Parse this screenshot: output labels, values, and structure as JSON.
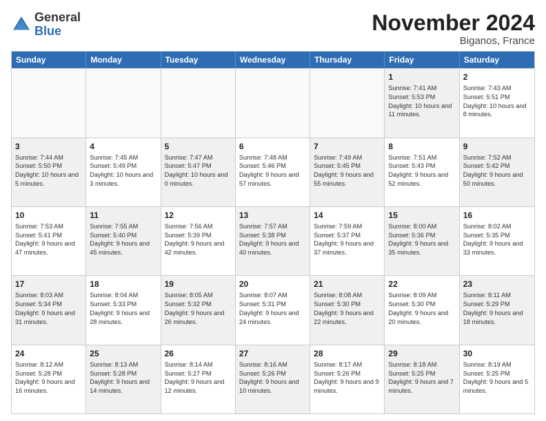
{
  "logo": {
    "general": "General",
    "blue": "Blue"
  },
  "header": {
    "month": "November 2024",
    "location": "Biganos, France"
  },
  "weekdays": [
    "Sunday",
    "Monday",
    "Tuesday",
    "Wednesday",
    "Thursday",
    "Friday",
    "Saturday"
  ],
  "rows": [
    [
      {
        "day": "",
        "text": "",
        "empty": true
      },
      {
        "day": "",
        "text": "",
        "empty": true
      },
      {
        "day": "",
        "text": "",
        "empty": true
      },
      {
        "day": "",
        "text": "",
        "empty": true
      },
      {
        "day": "",
        "text": "",
        "empty": true
      },
      {
        "day": "1",
        "text": "Sunrise: 7:41 AM\nSunset: 5:53 PM\nDaylight: 10 hours and 11 minutes.",
        "empty": false,
        "shaded": true
      },
      {
        "day": "2",
        "text": "Sunrise: 7:43 AM\nSunset: 5:51 PM\nDaylight: 10 hours and 8 minutes.",
        "empty": false,
        "shaded": false
      }
    ],
    [
      {
        "day": "3",
        "text": "Sunrise: 7:44 AM\nSunset: 5:50 PM\nDaylight: 10 hours and 5 minutes.",
        "empty": false,
        "shaded": true
      },
      {
        "day": "4",
        "text": "Sunrise: 7:45 AM\nSunset: 5:49 PM\nDaylight: 10 hours and 3 minutes.",
        "empty": false,
        "shaded": false
      },
      {
        "day": "5",
        "text": "Sunrise: 7:47 AM\nSunset: 5:47 PM\nDaylight: 10 hours and 0 minutes.",
        "empty": false,
        "shaded": true
      },
      {
        "day": "6",
        "text": "Sunrise: 7:48 AM\nSunset: 5:46 PM\nDaylight: 9 hours and 57 minutes.",
        "empty": false,
        "shaded": false
      },
      {
        "day": "7",
        "text": "Sunrise: 7:49 AM\nSunset: 5:45 PM\nDaylight: 9 hours and 55 minutes.",
        "empty": false,
        "shaded": true
      },
      {
        "day": "8",
        "text": "Sunrise: 7:51 AM\nSunset: 5:43 PM\nDaylight: 9 hours and 52 minutes.",
        "empty": false,
        "shaded": false
      },
      {
        "day": "9",
        "text": "Sunrise: 7:52 AM\nSunset: 5:42 PM\nDaylight: 9 hours and 50 minutes.",
        "empty": false,
        "shaded": true
      }
    ],
    [
      {
        "day": "10",
        "text": "Sunrise: 7:53 AM\nSunset: 5:41 PM\nDaylight: 9 hours and 47 minutes.",
        "empty": false,
        "shaded": false
      },
      {
        "day": "11",
        "text": "Sunrise: 7:55 AM\nSunset: 5:40 PM\nDaylight: 9 hours and 45 minutes.",
        "empty": false,
        "shaded": true
      },
      {
        "day": "12",
        "text": "Sunrise: 7:56 AM\nSunset: 5:39 PM\nDaylight: 9 hours and 42 minutes.",
        "empty": false,
        "shaded": false
      },
      {
        "day": "13",
        "text": "Sunrise: 7:57 AM\nSunset: 5:38 PM\nDaylight: 9 hours and 40 minutes.",
        "empty": false,
        "shaded": true
      },
      {
        "day": "14",
        "text": "Sunrise: 7:59 AM\nSunset: 5:37 PM\nDaylight: 9 hours and 37 minutes.",
        "empty": false,
        "shaded": false
      },
      {
        "day": "15",
        "text": "Sunrise: 8:00 AM\nSunset: 5:36 PM\nDaylight: 9 hours and 35 minutes.",
        "empty": false,
        "shaded": true
      },
      {
        "day": "16",
        "text": "Sunrise: 8:02 AM\nSunset: 5:35 PM\nDaylight: 9 hours and 33 minutes.",
        "empty": false,
        "shaded": false
      }
    ],
    [
      {
        "day": "17",
        "text": "Sunrise: 8:03 AM\nSunset: 5:34 PM\nDaylight: 9 hours and 31 minutes.",
        "empty": false,
        "shaded": true
      },
      {
        "day": "18",
        "text": "Sunrise: 8:04 AM\nSunset: 5:33 PM\nDaylight: 9 hours and 28 minutes.",
        "empty": false,
        "shaded": false
      },
      {
        "day": "19",
        "text": "Sunrise: 8:05 AM\nSunset: 5:32 PM\nDaylight: 9 hours and 26 minutes.",
        "empty": false,
        "shaded": true
      },
      {
        "day": "20",
        "text": "Sunrise: 8:07 AM\nSunset: 5:31 PM\nDaylight: 9 hours and 24 minutes.",
        "empty": false,
        "shaded": false
      },
      {
        "day": "21",
        "text": "Sunrise: 8:08 AM\nSunset: 5:30 PM\nDaylight: 9 hours and 22 minutes.",
        "empty": false,
        "shaded": true
      },
      {
        "day": "22",
        "text": "Sunrise: 8:09 AM\nSunset: 5:30 PM\nDaylight: 9 hours and 20 minutes.",
        "empty": false,
        "shaded": false
      },
      {
        "day": "23",
        "text": "Sunrise: 8:11 AM\nSunset: 5:29 PM\nDaylight: 9 hours and 18 minutes.",
        "empty": false,
        "shaded": true
      }
    ],
    [
      {
        "day": "24",
        "text": "Sunrise: 8:12 AM\nSunset: 5:28 PM\nDaylight: 9 hours and 16 minutes.",
        "empty": false,
        "shaded": false
      },
      {
        "day": "25",
        "text": "Sunrise: 8:13 AM\nSunset: 5:28 PM\nDaylight: 9 hours and 14 minutes.",
        "empty": false,
        "shaded": true
      },
      {
        "day": "26",
        "text": "Sunrise: 8:14 AM\nSunset: 5:27 PM\nDaylight: 9 hours and 12 minutes.",
        "empty": false,
        "shaded": false
      },
      {
        "day": "27",
        "text": "Sunrise: 8:16 AM\nSunset: 5:26 PM\nDaylight: 9 hours and 10 minutes.",
        "empty": false,
        "shaded": true
      },
      {
        "day": "28",
        "text": "Sunrise: 8:17 AM\nSunset: 5:26 PM\nDaylight: 9 hours and 9 minutes.",
        "empty": false,
        "shaded": false
      },
      {
        "day": "29",
        "text": "Sunrise: 8:18 AM\nSunset: 5:25 PM\nDaylight: 9 hours and 7 minutes.",
        "empty": false,
        "shaded": true
      },
      {
        "day": "30",
        "text": "Sunrise: 8:19 AM\nSunset: 5:25 PM\nDaylight: 9 hours and 5 minutes.",
        "empty": false,
        "shaded": false
      }
    ]
  ]
}
